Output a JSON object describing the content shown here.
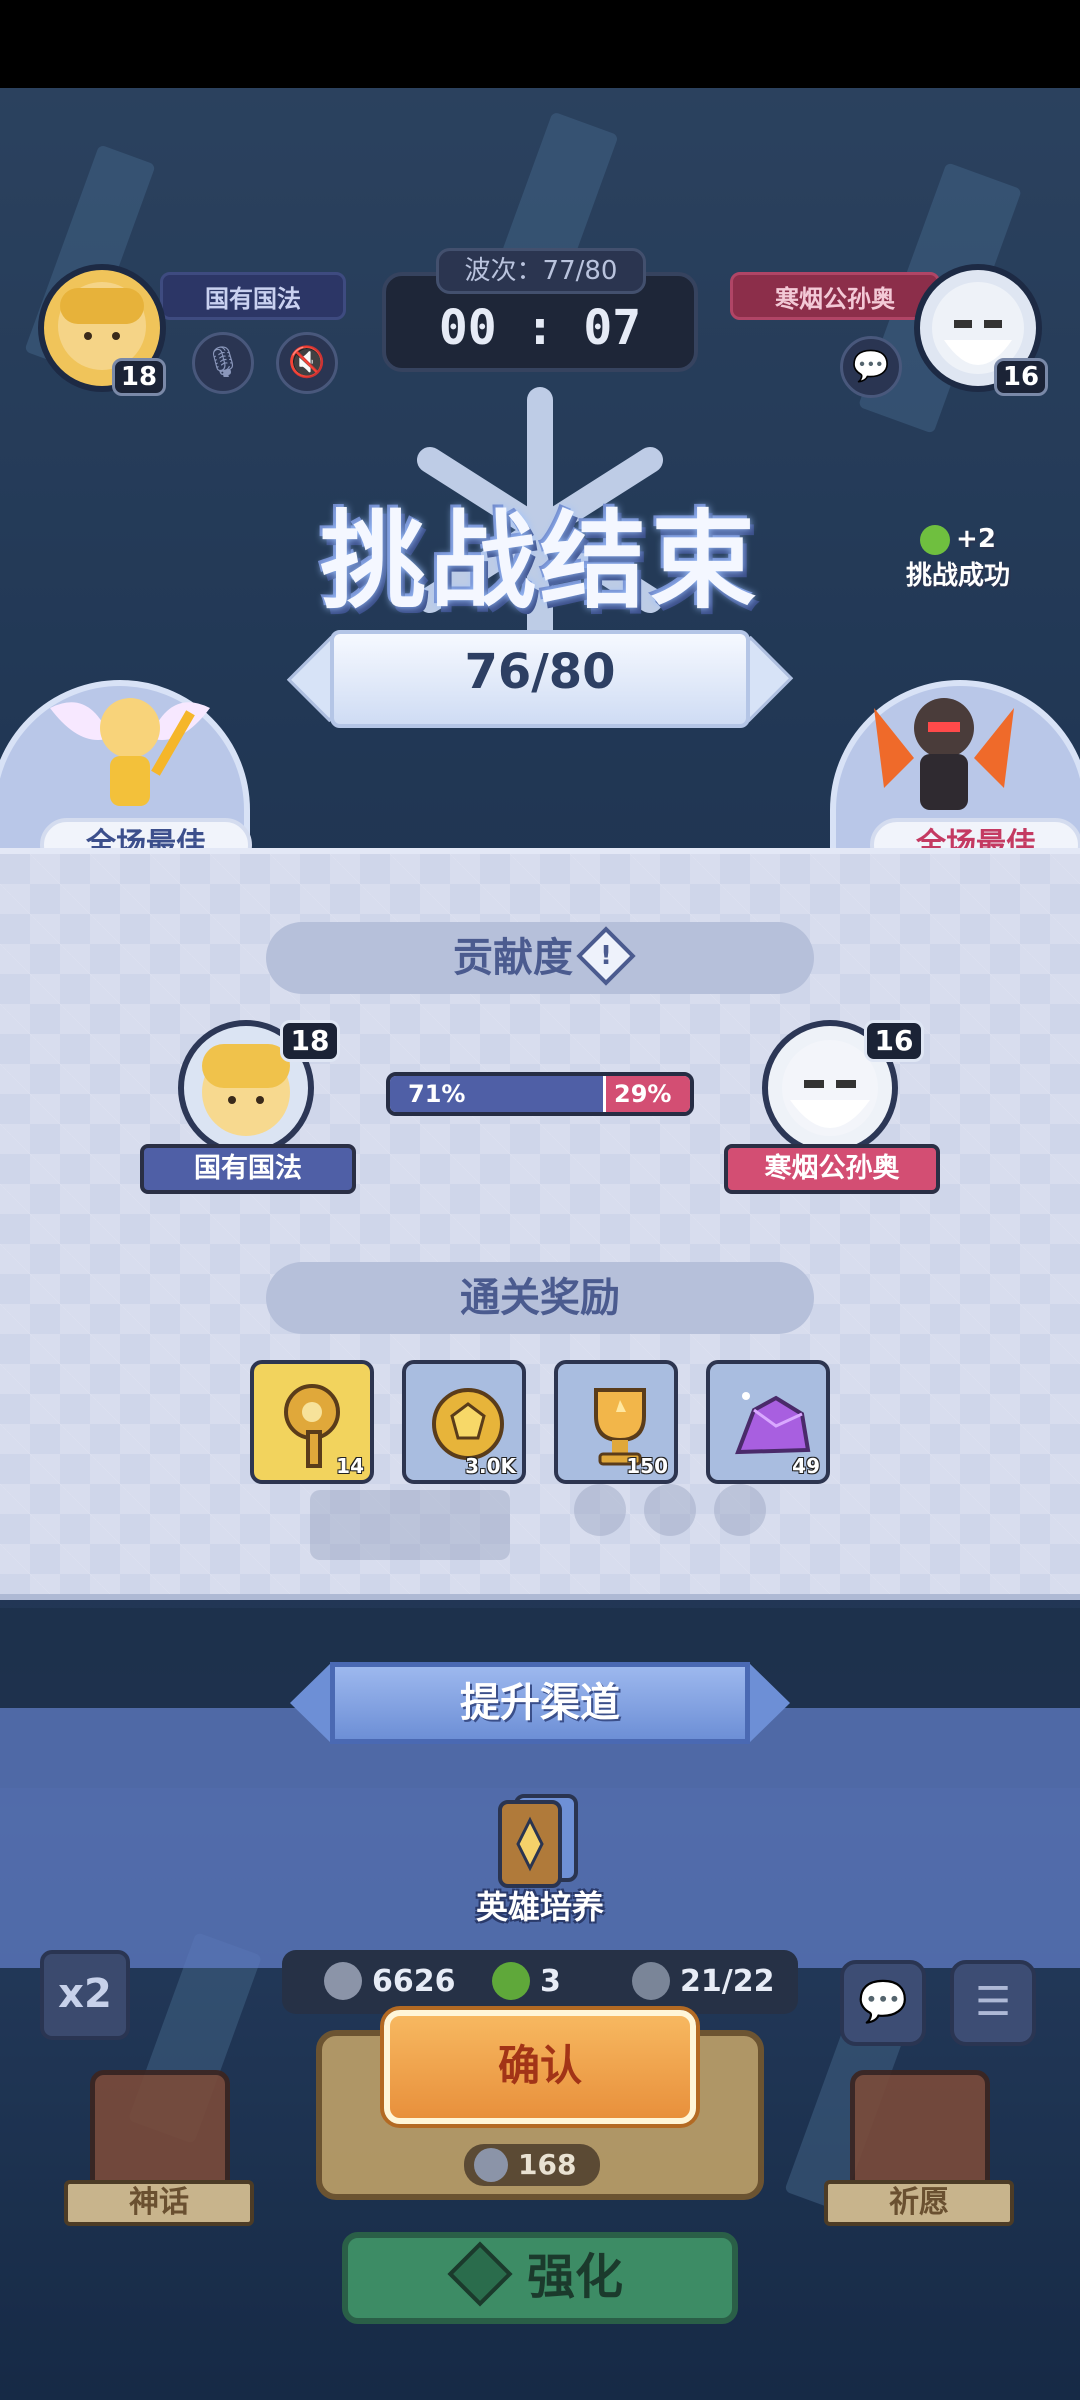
{
  "hud": {
    "wave": "波次：77/80",
    "timer": "00 : 07",
    "rate_bonus": "+2",
    "challenge_success": "挑战成功"
  },
  "players": {
    "left": {
      "name": "国有国法",
      "level": "18"
    },
    "right": {
      "name": "寒烟公孙奥",
      "level": "16"
    }
  },
  "banner": {
    "title": "挑战结束",
    "score": "76/80"
  },
  "mvp": {
    "left_label": "全场最佳",
    "right_label": "全场最佳"
  },
  "contribution": {
    "title": "贡献度",
    "info_icon": "info-icon",
    "left_percent": "71%",
    "right_percent": "29%",
    "left_fraction": 0.71,
    "colors": {
      "left": "#4f5fa6",
      "right": "#d34e73"
    }
  },
  "rewards": {
    "title": "通关奖励",
    "items": [
      {
        "icon": "key-icon",
        "count": "14",
        "bg": "#f2d35d"
      },
      {
        "icon": "gold-coin-icon",
        "count": "3.0K",
        "bg": "#a9bde0"
      },
      {
        "icon": "trophy-icon",
        "count": "150",
        "bg": "#a9bde0"
      },
      {
        "icon": "purple-crystal-icon",
        "count": "49",
        "bg": "#a9bde0"
      }
    ]
  },
  "upgrade": {
    "title": "提升渠道",
    "option": "英雄培养"
  },
  "bottom_hud": {
    "x2": "x2",
    "coins": "6626",
    "clovers": "3",
    "units": "21/22",
    "confirm": "确认",
    "summon_cost": "168",
    "left_shop": "神话",
    "right_shop": "祈愿",
    "enhance": "强化"
  }
}
